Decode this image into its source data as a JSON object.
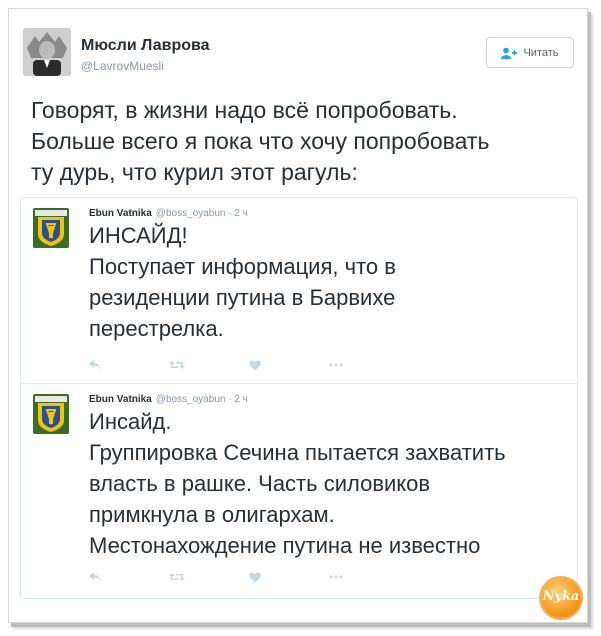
{
  "tweet": {
    "author_name": "Мюсли Лаврова",
    "author_handle": "@LavrovMuesli",
    "follow_label": "Читать",
    "text": "Говорят, в жизни надо всё попробовать.\nБольше всего я пока что хочу попробовать\nту дурь, что курил этот рагуль:"
  },
  "quoted": [
    {
      "author_name": "Ebun Vatnika",
      "handle_time": "@boss_oyabun · 2 ч",
      "text": "ИНСАЙД!\nПоступает информация, что в\nрезиденции путина в Барвихе\nперестрелка."
    },
    {
      "author_name": "Ebun Vatnika",
      "handle_time": "@boss_oyabun · 2 ч",
      "text": "Инсайд.\nГруппировка Сечина пытается захватить\nвласть в рашке. Часть силовиков\nпримкнула в олигархам.\nМестонахождение путина не известно"
    }
  ],
  "icons": {
    "reply": "reply-icon",
    "retweet": "retweet-icon",
    "like": "heart-icon",
    "more": "more-icon",
    "follow": "follow-user-icon"
  },
  "watermark": "Nyka",
  "colors": {
    "text": "#292f33",
    "secondary": "#8899a6",
    "icon": "#ccd6dd",
    "badge_green": "#3b6e24",
    "badge_yellow": "#f1c40f",
    "badge_blue": "#2c4f8f",
    "watermark": "#f39a1e"
  }
}
